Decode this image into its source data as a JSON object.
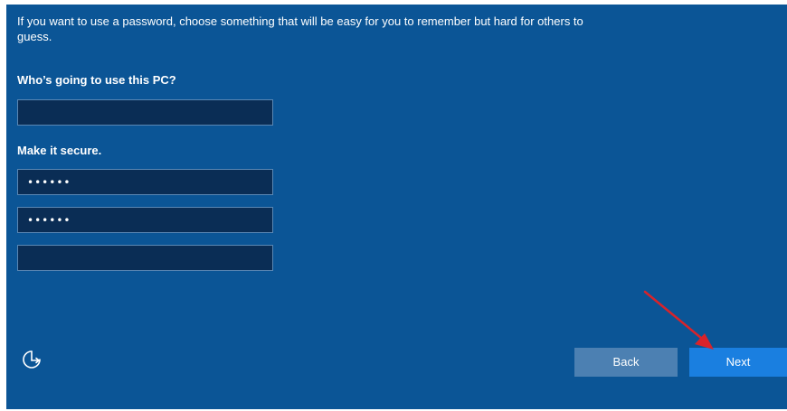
{
  "intro_text": "If you want to use a password, choose something that will be easy for you to remember but hard for others to guess.",
  "user_section": {
    "label": "Who’s going to use this PC?",
    "username_value": ""
  },
  "secure_section": {
    "label": "Make it secure.",
    "password_value": "••••••",
    "confirm_value": "••••••",
    "hint_value": ""
  },
  "buttons": {
    "back_label": "Back",
    "next_label": "Next"
  },
  "icons": {
    "ease_of_access": "ease-of-access-icon",
    "annotation": "red-arrow-annotation"
  },
  "colors": {
    "background": "#0b5596",
    "field_background": "#0a2d55",
    "back_button": "#4c80b2",
    "next_button": "#1a7fe0",
    "annotation_arrow": "#d9232a"
  }
}
